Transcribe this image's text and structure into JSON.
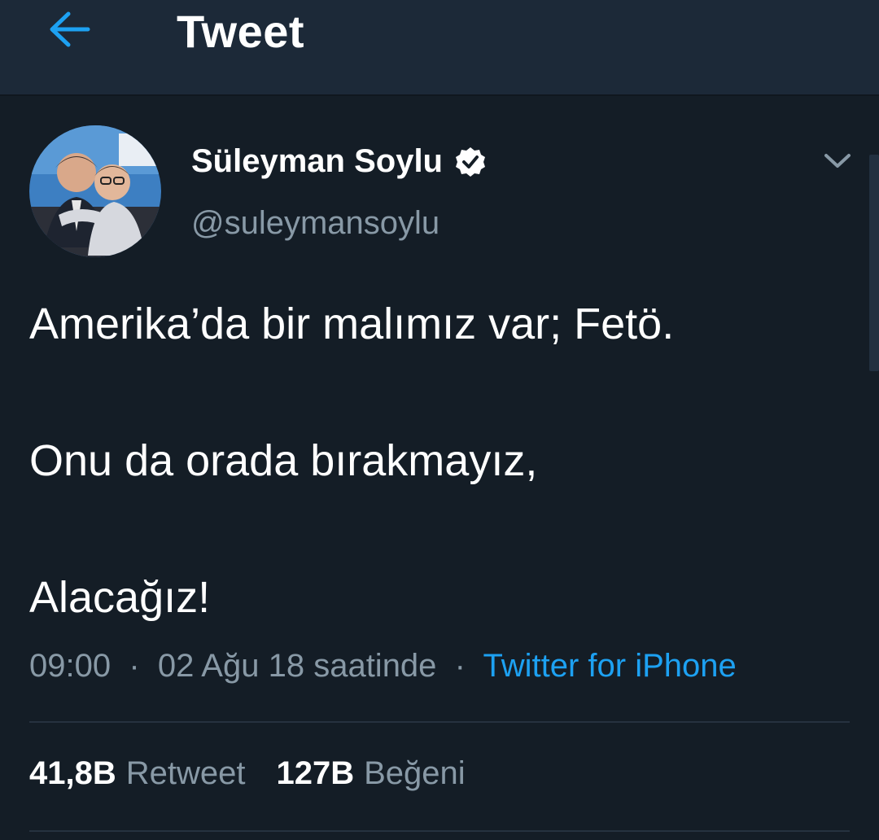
{
  "header": {
    "title": "Tweet",
    "back_icon": "arrow-left-icon",
    "accent": "#1da1f2"
  },
  "tweet": {
    "author": {
      "name": "Süleyman Soylu",
      "handle": "@suleymansoylu",
      "verified_icon": "verified-badge-icon",
      "avatar": "profile-photo"
    },
    "menu_icon": "chevron-down-icon",
    "lines": [
      "Amerika’da bir malımız var; Fetö.",
      "Onu da orada bırakmayız,",
      "Alacağız!"
    ],
    "time": "09:00",
    "separator": "·",
    "date": "02 Ağu 18 saatinde",
    "source": "Twitter for iPhone",
    "stats": {
      "retweets_count": "41,8B",
      "retweets_label": "Retweet",
      "likes_count": "127B",
      "likes_label": "Beğeni"
    }
  },
  "colors": {
    "background": "#141d26",
    "header_bg": "#1c2938",
    "secondary_text": "#8899a6",
    "link": "#1da1f2"
  }
}
